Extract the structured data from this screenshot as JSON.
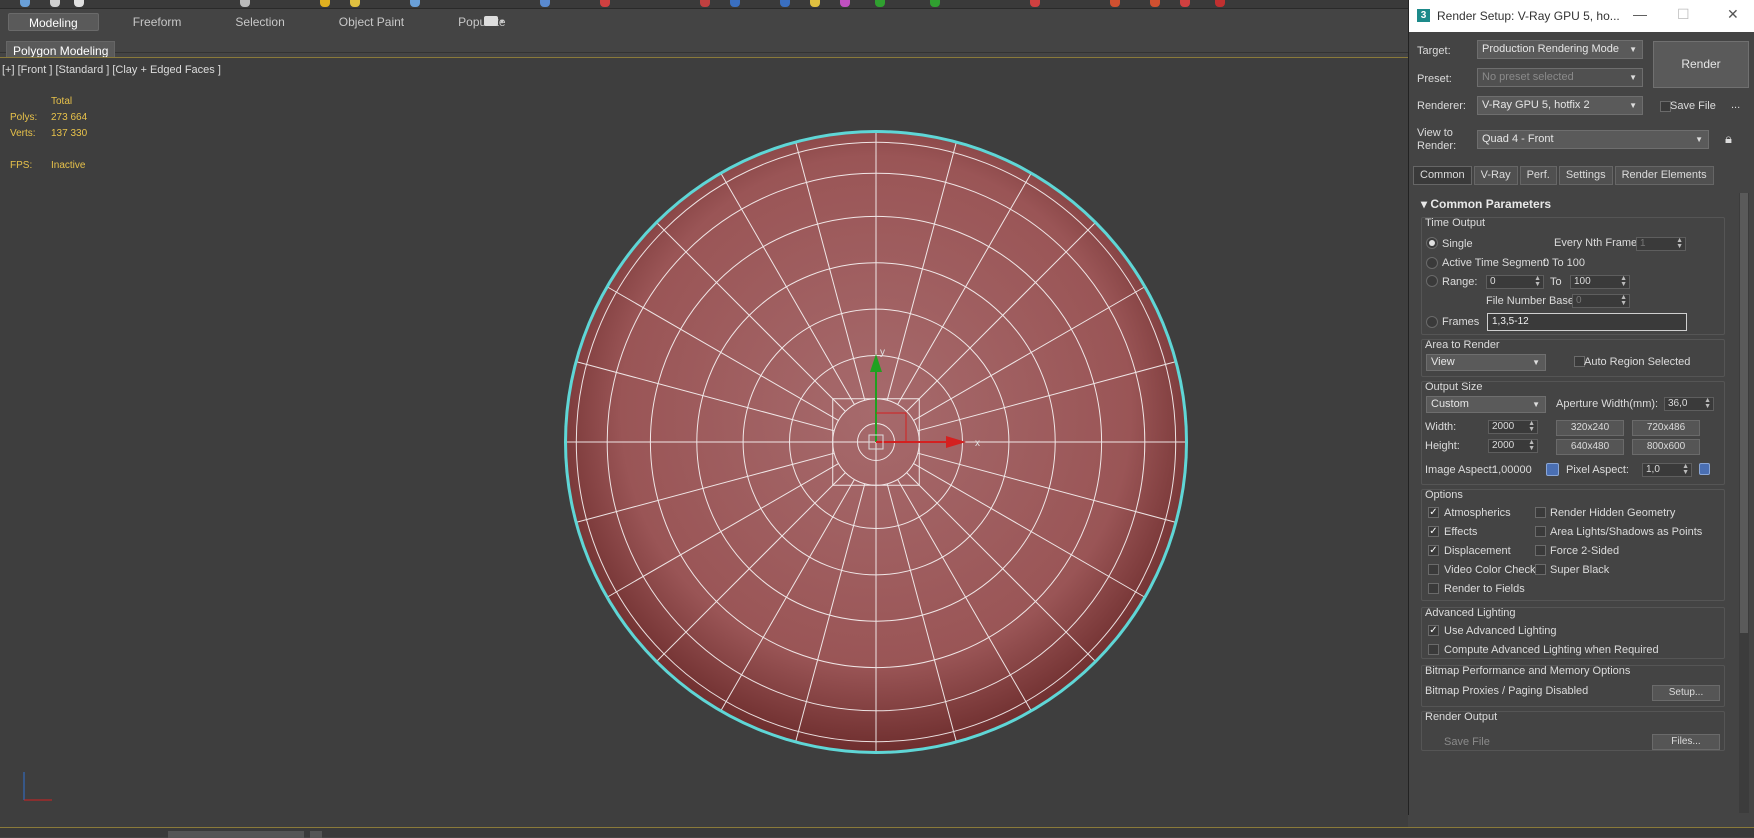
{
  "ribbon": {
    "tabs": [
      "Modeling",
      "Freeform",
      "Selection",
      "Object Paint",
      "Populate"
    ],
    "active_tab": "Modeling",
    "sub_label": "Polygon Modeling"
  },
  "viewport": {
    "label": "[+] [Front ] [Standard ] [Clay + Edged Faces ]",
    "stats": {
      "total_header": "Total",
      "polys_label": "Polys:",
      "polys_value": "273 664",
      "verts_label": "Verts:",
      "verts_value": "137 330",
      "fps_label": "FPS:",
      "fps_value": "Inactive"
    },
    "gizmo": {
      "x_label": "x",
      "y_label": "y"
    },
    "colors": {
      "sphere": "#a05a5a",
      "selection_outline": "#5fd6d6",
      "wire": "#ffffff",
      "axis_x": "#d42020",
      "axis_y": "#20a020"
    }
  },
  "dialog": {
    "title": "Render Setup: V-Ray GPU 5, ho...",
    "target_label": "Target:",
    "target_value": "Production Rendering Mode",
    "preset_label": "Preset:",
    "preset_value": "No preset selected",
    "renderer_label": "Renderer:",
    "renderer_value": "V-Ray GPU 5, hotfix 2",
    "save_file_label": "Save File",
    "more_label": "...",
    "view_label_1": "View to",
    "view_label_2": "Render:",
    "view_value": "Quad 4 - Front",
    "render_button": "Render",
    "tabs": [
      "Common",
      "V-Ray",
      "Perf.",
      "Settings",
      "Render Elements"
    ],
    "active_tab": "Common",
    "rollout_title": "Common Parameters",
    "time_output": {
      "title": "Time Output",
      "single": "Single",
      "every_nth_label": "Every Nth Frame:",
      "every_nth_value": "1",
      "active_segment_label": "Active Time Segment:",
      "active_segment_value": "0 To 100",
      "range_label": "Range:",
      "range_from": "0",
      "range_to_label": "To",
      "range_to": "100",
      "file_number_base_label": "File Number Base:",
      "file_number_base_value": "0",
      "frames_label": "Frames",
      "frames_value": "1,3,5-12"
    },
    "area_to_render": {
      "title": "Area to Render",
      "value": "View",
      "auto_region_label": "Auto Region Selected"
    },
    "output_size": {
      "title": "Output Size",
      "preset_value": "Custom",
      "aperture_label": "Aperture Width(mm):",
      "aperture_value": "36,0",
      "width_label": "Width:",
      "width_value": "2000",
      "height_label": "Height:",
      "height_value": "2000",
      "presets": [
        "320x240",
        "720x486",
        "640x480",
        "800x600"
      ],
      "image_aspect_label": "Image Aspect:",
      "image_aspect_value": "1,00000",
      "pixel_aspect_label": "Pixel Aspect:",
      "pixel_aspect_value": "1,0"
    },
    "options": {
      "title": "Options",
      "left": [
        {
          "label": "Atmospherics",
          "checked": true
        },
        {
          "label": "Effects",
          "checked": true
        },
        {
          "label": "Displacement",
          "checked": true
        },
        {
          "label": "Video Color Check",
          "checked": false
        },
        {
          "label": "Render to Fields",
          "checked": false
        }
      ],
      "right": [
        {
          "label": "Render Hidden Geometry",
          "checked": false
        },
        {
          "label": "Area Lights/Shadows as Points",
          "checked": false
        },
        {
          "label": "Force 2-Sided",
          "checked": false
        },
        {
          "label": "Super Black",
          "checked": false
        }
      ]
    },
    "advanced_lighting": {
      "title": "Advanced Lighting",
      "use_label": "Use Advanced Lighting",
      "compute_label": "Compute Advanced Lighting when Required"
    },
    "bitmap": {
      "title": "Bitmap Performance and Memory Options",
      "status": "Bitmap Proxies / Paging Disabled",
      "setup_button": "Setup..."
    },
    "render_output": {
      "title": "Render Output",
      "save_file_label": "Save File",
      "files_button": "Files..."
    }
  }
}
